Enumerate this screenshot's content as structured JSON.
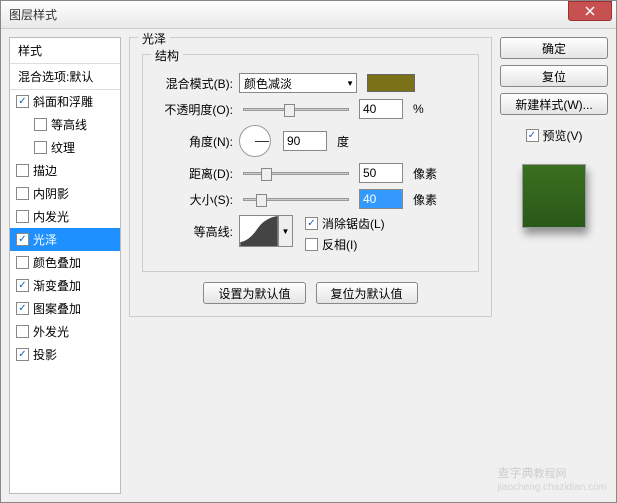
{
  "title": "图层样式",
  "sidebar": {
    "header": "样式",
    "subheader": "混合选项:默认",
    "items": [
      {
        "label": "斜面和浮雕",
        "checked": true,
        "indent": false
      },
      {
        "label": "等高线",
        "checked": false,
        "indent": true
      },
      {
        "label": "纹理",
        "checked": false,
        "indent": true
      },
      {
        "label": "描边",
        "checked": false,
        "indent": false
      },
      {
        "label": "内阴影",
        "checked": false,
        "indent": false
      },
      {
        "label": "内发光",
        "checked": false,
        "indent": false
      },
      {
        "label": "光泽",
        "checked": true,
        "indent": false,
        "selected": true
      },
      {
        "label": "颜色叠加",
        "checked": false,
        "indent": false
      },
      {
        "label": "渐变叠加",
        "checked": true,
        "indent": false
      },
      {
        "label": "图案叠加",
        "checked": true,
        "indent": false
      },
      {
        "label": "外发光",
        "checked": false,
        "indent": false
      },
      {
        "label": "投影",
        "checked": true,
        "indent": false
      }
    ]
  },
  "panel": {
    "title": "光泽",
    "structure": "结构",
    "blend_mode_label": "混合模式(B):",
    "blend_mode_value": "颜色减淡",
    "swatch_color": "#7a7118",
    "opacity_label": "不透明度(O):",
    "opacity_value": "40",
    "opacity_unit": "%",
    "angle_label": "角度(N):",
    "angle_value": "90",
    "angle_unit": "度",
    "distance_label": "距离(D):",
    "distance_value": "50",
    "distance_unit": "像素",
    "size_label": "大小(S):",
    "size_value": "40",
    "size_unit": "像素",
    "contour_label": "等高线:",
    "antialias_label": "消除锯齿(L)",
    "antialias_checked": true,
    "invert_label": "反相(I)",
    "invert_checked": false,
    "reset_default": "设置为默认值",
    "restore_default": "复位为默认值"
  },
  "right": {
    "ok": "确定",
    "cancel": "复位",
    "new_style": "新建样式(W)...",
    "preview_label": "预览(V)",
    "preview_checked": true
  },
  "watermark": {
    "main": "查字典",
    "sub": "jiaocheng.chazidian.com",
    "tag": "教程网"
  }
}
